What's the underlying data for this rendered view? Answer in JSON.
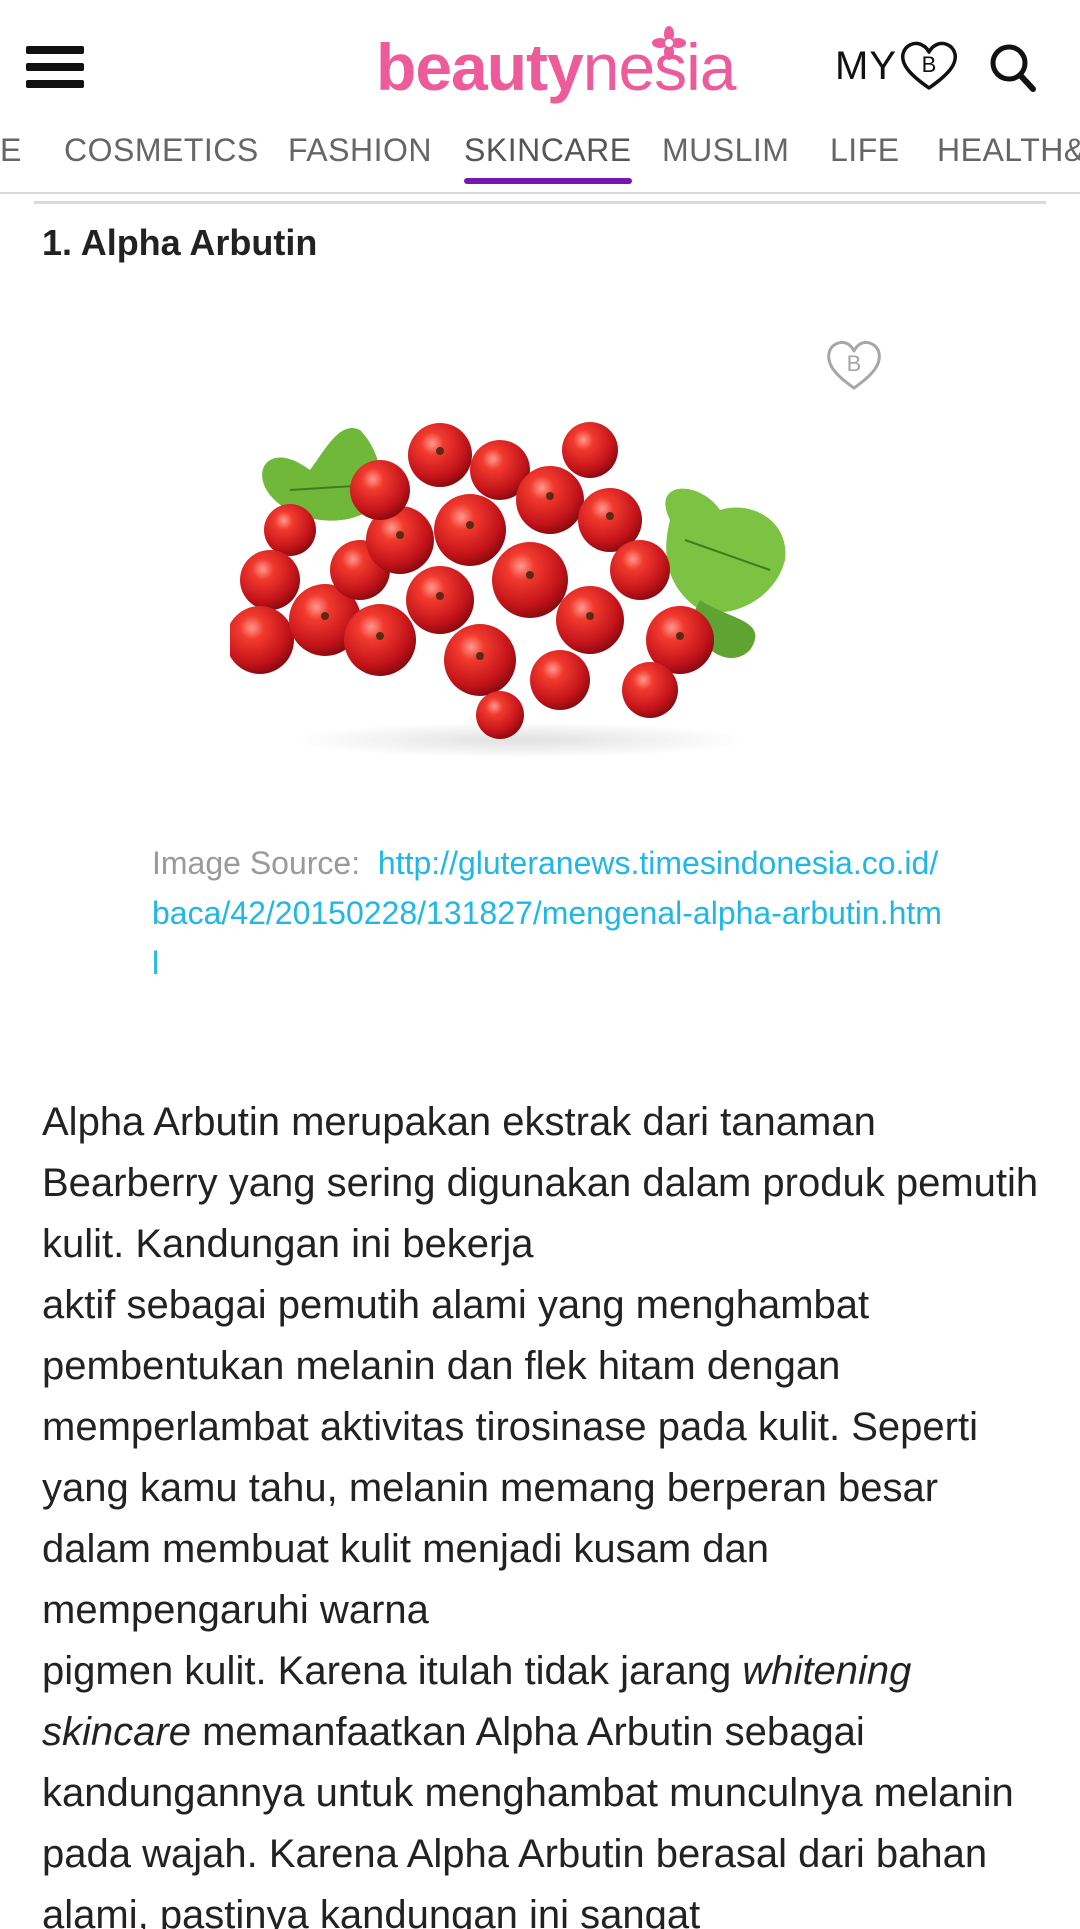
{
  "header": {
    "logo_part1": "beauty",
    "logo_part2": "nesia",
    "my_label": "MY",
    "my_badge_letter": "B",
    "brand_color": "#ee5b9b",
    "icons": [
      "hamburger-menu-icon",
      "heart-b-icon",
      "search-icon"
    ]
  },
  "nav": {
    "tabs": [
      {
        "label": "E"
      },
      {
        "label": "COSMETICS"
      },
      {
        "label": "FASHION"
      },
      {
        "label": "SKINCARE",
        "active": true
      },
      {
        "label": "MUSLIM"
      },
      {
        "label": "LIFE"
      },
      {
        "label": "HEALTH&F"
      }
    ],
    "active_color": "#7a16b0"
  },
  "article": {
    "heading": "1. Alpha Arbutin",
    "fav_badge_letter": "B",
    "image_source_label": "Image Source:",
    "image_source_url": "http://gluteranews.timesindonesia.co.id/baca/42/20150228/131827/mengenal-alpha-arbutin.html",
    "link_color": "#1fb8e6",
    "paragraph_part1": "Alpha Arbutin merupakan ekstrak dari tanaman Bearberry yang sering digunakan dalam produk pemutih kulit. Kandungan ini bekerja",
    "paragraph_part2": "aktif sebagai pemutih alami yang menghambat pembentukan melanin dan flek hitam dengan memperlambat aktivitas tirosinase pada kulit. Seperti yang kamu tahu, melanin memang berperan besar dalam membuat kulit menjadi kusam dan mempengaruhi warna",
    "paragraph_part3": "pigmen kulit. Karena itulah tidak jarang ",
    "paragraph_italic": "whitening skincare",
    "paragraph_part4": " memanfaatkan Alpha Arbutin sebagai kandungannya untuk menghambat munculnya melanin pada wajah. Karena Alpha Arbutin berasal dari bahan alami, pastinya kandungan ini sangat"
  }
}
